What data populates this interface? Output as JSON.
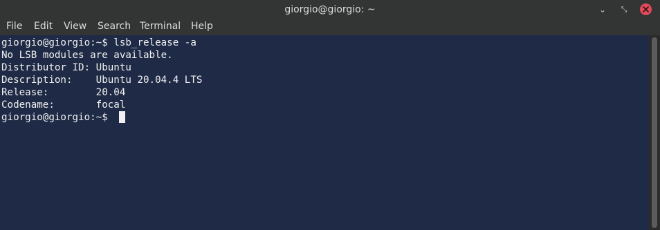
{
  "window": {
    "title": "giorgio@giorgio: ~",
    "minimize_glyph": "⌄",
    "maximize_glyph": "⤡",
    "close_icon": "close-icon"
  },
  "menu": {
    "file": "File",
    "edit": "Edit",
    "view": "View",
    "search": "Search",
    "terminal": "Terminal",
    "help": "Help"
  },
  "terminal": {
    "lines": [
      "giorgio@giorgio:~$ lsb_release -a",
      "No LSB modules are available.",
      "Distributor ID:\tUbuntu",
      "Description:\tUbuntu 20.04.4 LTS",
      "Release:\t20.04",
      "Codename:\tfocal",
      "giorgio@giorgio:~$ "
    ]
  },
  "colors": {
    "terminal_bg": "#1f2b46",
    "text": "#f0f0f0",
    "close_button": "#e24a5a"
  }
}
